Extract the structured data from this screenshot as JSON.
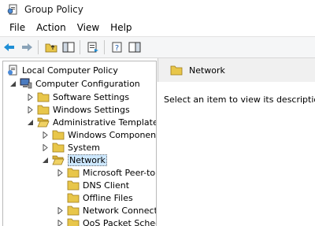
{
  "window": {
    "title": "Group Policy"
  },
  "menu": [
    {
      "label": "File"
    },
    {
      "label": "Action"
    },
    {
      "label": "View"
    },
    {
      "label": "Help"
    }
  ],
  "toolbar": {
    "buttons": [
      {
        "icon": "back-arrow-icon"
      },
      {
        "icon": "forward-arrow-icon"
      },
      {
        "icon": "up-folder-icon"
      },
      {
        "icon": "show-hide-tree-icon"
      },
      {
        "icon": "export-list-icon"
      },
      {
        "icon": "help-icon"
      },
      {
        "icon": "show-hide-action-pane-icon"
      }
    ]
  },
  "tree": {
    "root": "Local Computer Policy",
    "computer_configuration": "Computer Configuration",
    "software_settings": "Software Settings",
    "windows_settings": "Windows Settings",
    "administrative_templates": "Administrative Templates",
    "windows_components": "Windows Componen",
    "system": "System",
    "network": "Network",
    "network_children": [
      {
        "label": "Microsoft Peer-to-",
        "expandable": true
      },
      {
        "label": "DNS Client",
        "expandable": false
      },
      {
        "label": "Offline Files",
        "expandable": false
      },
      {
        "label": "Network Connect",
        "expandable": true
      },
      {
        "label": "QoS Packet Schec",
        "expandable": true
      }
    ]
  },
  "details": {
    "header": "Network",
    "description": "Select an item to view its description."
  },
  "colors": {
    "folder": "#e8c64a",
    "selection": "#cde8ff",
    "header_bg": "#f0f0f0",
    "arrow": "#1f8fd6"
  }
}
